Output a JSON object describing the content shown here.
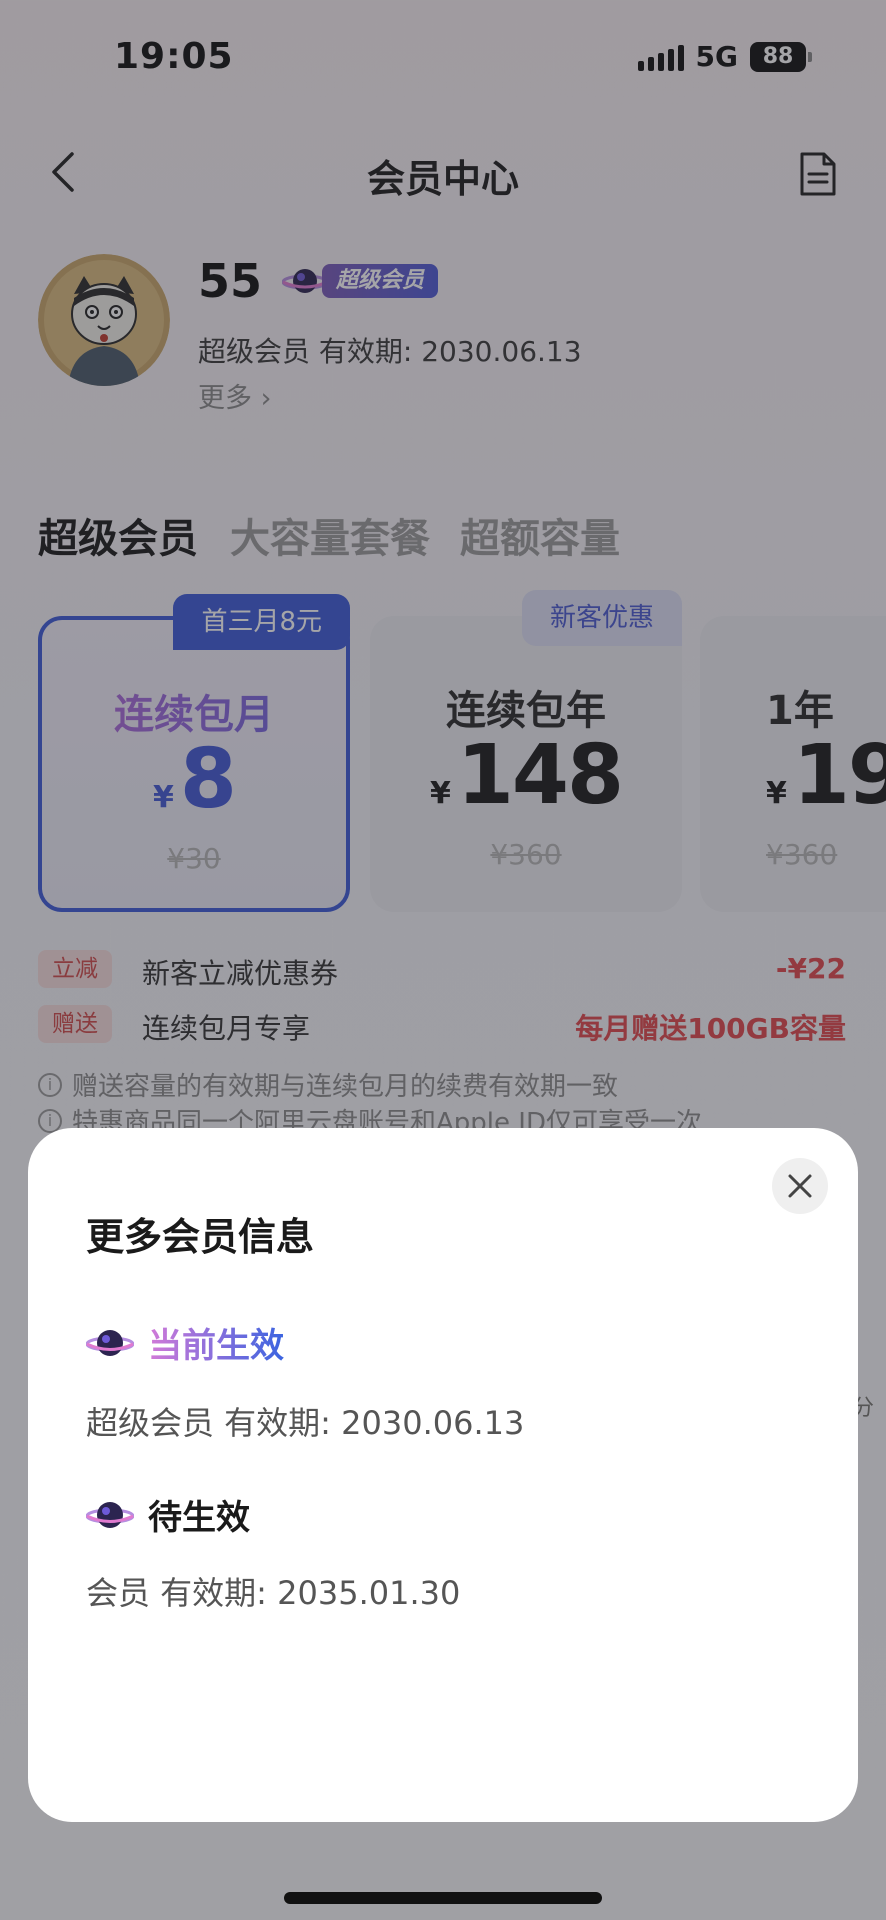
{
  "status_bar": {
    "time": "19:05",
    "network": "5G",
    "battery": "88"
  },
  "nav": {
    "title": "会员中心"
  },
  "profile": {
    "username": "55",
    "badge": "超级会员",
    "vip_line": "超级会员 有效期: 2030.06.13",
    "more": "更多 ›"
  },
  "tabs": [
    {
      "label": "超级会员",
      "active": true
    },
    {
      "label": "大容量套餐",
      "active": false
    },
    {
      "label": "超额容量",
      "active": false
    }
  ],
  "plans": [
    {
      "tag": "首三月8元",
      "name": "连续包月",
      "currency": "¥",
      "price": "8",
      "original": "¥30",
      "selected": true
    },
    {
      "tag": "新客优惠",
      "name": "连续包年",
      "currency": "¥",
      "price": "148",
      "original": "¥360",
      "selected": false
    },
    {
      "tag": "",
      "name": "1年",
      "currency": "¥",
      "price": "19",
      "original": "¥360",
      "selected": false
    }
  ],
  "promos": [
    {
      "tag": "立减",
      "text": "新客立减优惠券",
      "value": "-¥22"
    },
    {
      "tag": "赠送",
      "text": "连续包月专享",
      "value": "每月赠送100GB容量"
    }
  ],
  "notes": [
    "赠送容量的有效期与连续包月的续费有效期一致",
    "特惠商品同一个阿里云盘账号和Apple ID仅可享受一次"
  ],
  "side_fragment": "分",
  "modal": {
    "title": "更多会员信息",
    "current_label": "当前生效",
    "current_line": "超级会员 有效期: 2030.06.13",
    "pending_label": "待生效",
    "pending_line": "会员 有效期: 2035.01.30"
  },
  "colors": {
    "accent": "#3d5ad8",
    "promo_red": "#e0484c",
    "overlay": "rgba(40,40,48,0.42)"
  },
  "icons": [
    "back-arrow-icon",
    "document-icon",
    "planet-icon",
    "close-icon",
    "info-icon"
  ]
}
